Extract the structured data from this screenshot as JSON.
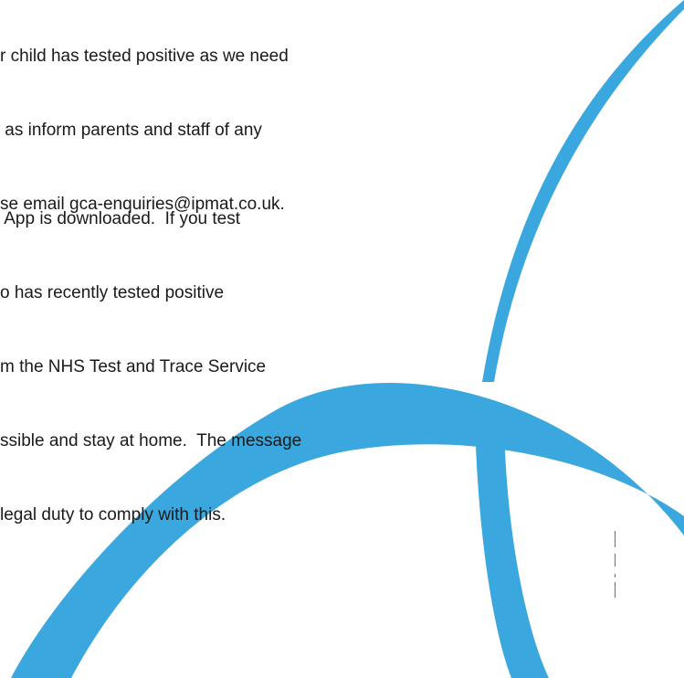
{
  "document": {
    "paragraphs": [
      {
        "lines": [
          "r child has tested positive as we need",
          " as inform parents and staff of any",
          "se email gca-enquiries@ipmat.co.uk."
        ]
      },
      {
        "lines": [
          " App is downloaded.  If you test",
          "o has recently tested positive",
          "m the NHS Test and Trace Service",
          "ssible and stay at home.  The message",
          "legal duty to comply with this."
        ]
      }
    ]
  },
  "colors": {
    "brand_blue": "#3aa8de",
    "page_background": "#ffffff",
    "text": "#1a1a1a",
    "rule_grey": "#6f6f6f"
  },
  "decoration": {
    "name": "blue-swoosh-graphic"
  }
}
